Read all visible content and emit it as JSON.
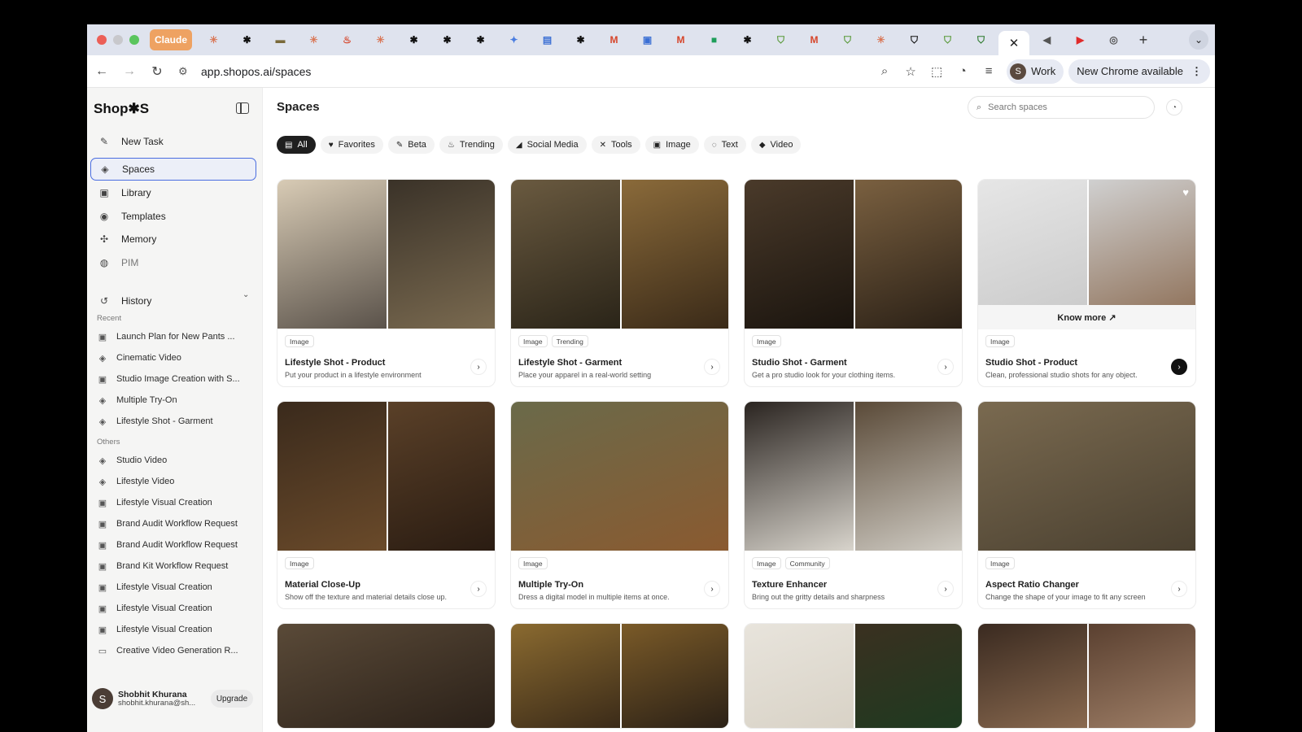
{
  "browser": {
    "traffic_lights": [
      "#ec5f57",
      "#c8c8cc",
      "#5ac55d"
    ],
    "tabs": [
      {
        "icon": "claude-tab",
        "label": "Claude"
      },
      {
        "icon": "claude-sunburst-icon",
        "glyph": "✳",
        "color": "#d97757"
      },
      {
        "icon": "asterisk-icon",
        "glyph": "✱",
        "color": "#111"
      },
      {
        "icon": "card-icon",
        "glyph": "▬",
        "color": "#7a6a3a"
      },
      {
        "icon": "claude-sunburst-icon",
        "glyph": "✳",
        "color": "#d97757"
      },
      {
        "icon": "steam-icon",
        "glyph": "♨",
        "color": "#d6452a"
      },
      {
        "icon": "claude-sunburst-icon",
        "glyph": "✳",
        "color": "#d97757"
      },
      {
        "icon": "asterisk-icon",
        "glyph": "✱",
        "color": "#111"
      },
      {
        "icon": "asterisk-icon",
        "glyph": "✱",
        "color": "#111"
      },
      {
        "icon": "asterisk-icon",
        "glyph": "✱",
        "color": "#111"
      },
      {
        "icon": "gemini-icon",
        "glyph": "✦",
        "color": "#4a7de0"
      },
      {
        "icon": "docs-icon",
        "glyph": "▤",
        "color": "#3b6fd4"
      },
      {
        "icon": "asterisk-icon",
        "glyph": "✱",
        "color": "#111"
      },
      {
        "icon": "gmail-icon",
        "glyph": "M",
        "color": "#d6452a"
      },
      {
        "icon": "calendar-icon",
        "glyph": "▣",
        "color": "#3b6fd4"
      },
      {
        "icon": "gmail-icon",
        "glyph": "M",
        "color": "#d6452a"
      },
      {
        "icon": "meet-icon",
        "glyph": "■",
        "color": "#1e9e5a"
      },
      {
        "icon": "asterisk-icon",
        "glyph": "✱",
        "color": "#111"
      },
      {
        "icon": "shopify-icon",
        "glyph": "⛉",
        "color": "#5a9a3a"
      },
      {
        "icon": "gmail-icon",
        "glyph": "M",
        "color": "#d6452a"
      },
      {
        "icon": "shopify-icon",
        "glyph": "⛉",
        "color": "#5a9a3a"
      },
      {
        "icon": "claude-sunburst-icon",
        "glyph": "✳",
        "color": "#d97757"
      },
      {
        "icon": "shopify-dark-icon",
        "glyph": "⛉",
        "color": "#111"
      },
      {
        "icon": "shopify-icon",
        "glyph": "⛉",
        "color": "#5a9a3a"
      },
      {
        "icon": "shopify-icon",
        "glyph": "⛉",
        "color": "#2d7a2d"
      }
    ],
    "active_tab_glyph": "✕",
    "tabs_after": [
      {
        "icon": "speaker-icon",
        "glyph": "◀",
        "color": "#555"
      },
      {
        "icon": "youtube-icon",
        "glyph": "▶",
        "color": "#e02a2a"
      },
      {
        "icon": "chrome-icon",
        "glyph": "◎",
        "color": "#555"
      }
    ],
    "new_tab_glyph": "+",
    "tab_menu_glyph": "⌄",
    "url": "app.shopos.ai/spaces",
    "profile_initial": "S",
    "profile_label": "Work",
    "update_label": "New Chrome available"
  },
  "sidebar": {
    "brand": "Shop✱S",
    "nav": [
      {
        "label": "New Task",
        "icon": "edit-icon",
        "glyph": "✎"
      },
      {
        "label": "Spaces",
        "icon": "spaces-icon",
        "glyph": "◈"
      },
      {
        "label": "Library",
        "icon": "library-icon",
        "glyph": "▣"
      },
      {
        "label": "Templates",
        "icon": "templates-icon",
        "glyph": "◉"
      },
      {
        "label": "Memory",
        "icon": "memory-icon",
        "glyph": "✣"
      },
      {
        "label": "PIM",
        "icon": "pim-icon",
        "glyph": "◍"
      }
    ],
    "history_label": "History",
    "recent_label": "Recent",
    "recent": [
      {
        "label": "Launch Plan for New Pants ...",
        "icon": "image-icon"
      },
      {
        "label": "Cinematic Video",
        "icon": "spaces-icon"
      },
      {
        "label": "Studio Image Creation with S...",
        "icon": "image-icon"
      },
      {
        "label": "Multiple Try-On",
        "icon": "spaces-icon"
      },
      {
        "label": "Lifestyle Shot - Garment",
        "icon": "spaces-icon"
      }
    ],
    "others_label": "Others",
    "others": [
      {
        "label": "Studio Video",
        "icon": "spaces-icon"
      },
      {
        "label": "Lifestyle Video",
        "icon": "spaces-icon"
      },
      {
        "label": "Lifestyle Visual Creation",
        "icon": "image-icon"
      },
      {
        "label": "Brand Audit Workflow Request",
        "icon": "image-icon"
      },
      {
        "label": "Brand Audit Workflow Request",
        "icon": "image-icon"
      },
      {
        "label": "Brand Kit Workflow Request",
        "icon": "image-icon"
      },
      {
        "label": "Lifestyle Visual Creation",
        "icon": "image-icon"
      },
      {
        "label": "Lifestyle Visual Creation",
        "icon": "image-icon"
      },
      {
        "label": "Lifestyle Visual Creation",
        "icon": "image-icon"
      },
      {
        "label": "Creative Video Generation R...",
        "icon": "video-icon"
      }
    ],
    "user": {
      "initial": "S",
      "name": "Shobhit Khurana",
      "email": "shobhit.khurana@sh..."
    },
    "upgrade_label": "Upgrade"
  },
  "main": {
    "title": "Spaces",
    "search_placeholder": "Search spaces",
    "chips": [
      {
        "label": "All",
        "icon": "folder-icon",
        "glyph": "▤"
      },
      {
        "label": "Favorites",
        "icon": "heart-icon",
        "glyph": "♥"
      },
      {
        "label": "Beta",
        "icon": "pencil-icon",
        "glyph": "✎"
      },
      {
        "label": "Trending",
        "icon": "fire-icon",
        "glyph": "♨"
      },
      {
        "label": "Social Media",
        "icon": "megaphone-icon",
        "glyph": "◢"
      },
      {
        "label": "Tools",
        "icon": "tools-icon",
        "glyph": "✕"
      },
      {
        "label": "Image",
        "icon": "image-icon",
        "glyph": "▣"
      },
      {
        "label": "Text",
        "icon": "chat-icon",
        "glyph": "◌"
      },
      {
        "label": "Video",
        "icon": "video-icon",
        "glyph": "◆"
      }
    ],
    "cards": [
      {
        "title": "Lifestyle Shot - Product",
        "desc": "Put your product in a lifestyle environment",
        "tags": [
          "Image"
        ],
        "left": [
          "#d8cbb5",
          "#5a524a"
        ],
        "right": [
          "#3a3228",
          "#7a6a50"
        ]
      },
      {
        "title": "Lifestyle Shot - Garment",
        "desc": "Place your apparel in a real-world setting",
        "tags": [
          "Image",
          "Trending"
        ],
        "left": [
          "#6a5a40",
          "#2a2418"
        ],
        "right": [
          "#8a6a3a",
          "#3a2a18"
        ]
      },
      {
        "title": "Studio Shot - Garment",
        "desc": "Get a pro studio look for your clothing items.",
        "tags": [
          "Image"
        ],
        "left": [
          "#4a3a2a",
          "#1a140e"
        ],
        "right": [
          "#7a6040",
          "#2a2016"
        ]
      },
      {
        "title": "Studio Shot - Product",
        "desc": "Clean, professional studio shots for any object.",
        "tags": [
          "Image"
        ],
        "left": [
          "#e6e6e6",
          "#c8c8c8"
        ],
        "right": [
          "#d0d0d0",
          "#8a6a50"
        ],
        "know_more": "Know more ↗",
        "favorite": true
      },
      {
        "title": "Material Close-Up",
        "desc": "Show off the texture and material details close up.",
        "tags": [
          "Image"
        ],
        "left": [
          "#3a2a1c",
          "#6a4a2a"
        ],
        "right": [
          "#5a4028",
          "#2a1c12"
        ]
      },
      {
        "title": "Multiple Try-On",
        "desc": "Dress a digital model in multiple items at once.",
        "tags": [
          "Image"
        ],
        "wide": true,
        "left": [
          "#6a6a4a",
          "#8a5a30"
        ],
        "right": [
          "#6a6a4a",
          "#8a5a30"
        ]
      },
      {
        "title": "Texture Enhancer",
        "desc": "Bring out the gritty details and sharpness",
        "tags": [
          "Image",
          "Community"
        ],
        "left": [
          "#2a2420",
          "#d8d4cc"
        ],
        "right": [
          "#5a4a38",
          "#d0ccc4"
        ]
      },
      {
        "title": "Aspect Ratio Changer",
        "desc": "Change the shape of your image to fit any screen",
        "tags": [
          "Image"
        ],
        "wide": true,
        "left": [
          "#7a6a50",
          "#4a4030"
        ],
        "right": [
          "#7a6a50",
          "#4a4030"
        ]
      },
      {
        "title": "",
        "desc": "",
        "tags": [],
        "wide": true,
        "short": true,
        "left": [
          "#5a4a38",
          "#2a2018"
        ],
        "right": [
          "#5a4a38",
          "#2a2018"
        ]
      },
      {
        "title": "",
        "desc": "",
        "tags": [],
        "short": true,
        "left": [
          "#8a6a30",
          "#3a2a18"
        ],
        "right": [
          "#7a5a28",
          "#2a2016"
        ]
      },
      {
        "title": "",
        "desc": "",
        "tags": [],
        "short": true,
        "left": [
          "#e8e4dc",
          "#d8d2c6"
        ],
        "right": [
          "#3a3020",
          "#1e3a20"
        ]
      },
      {
        "title": "",
        "desc": "",
        "tags": [],
        "short": true,
        "left": [
          "#3a2a20",
          "#8a6a50"
        ],
        "right": [
          "#5a4030",
          "#a08068"
        ]
      }
    ]
  }
}
